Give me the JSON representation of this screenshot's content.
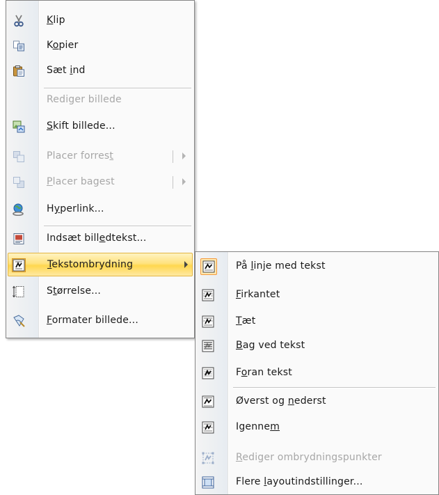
{
  "main_menu": {
    "items": [
      {
        "id": "cut",
        "label": "Klip",
        "accel_index": 0,
        "icon": "scissors-icon",
        "disabled": false
      },
      {
        "id": "copy",
        "label": "Kopier",
        "accel_index": 1,
        "icon": "copy-icon",
        "disabled": false
      },
      {
        "id": "paste",
        "label": "Sæt ind",
        "accel_index": 4,
        "icon": "paste-icon",
        "disabled": false
      },
      {
        "id": "edit-picture",
        "label": "Rediger billede",
        "accel_index": -1,
        "icon": "",
        "disabled": true
      },
      {
        "id": "change-picture",
        "label": "Skift billede...",
        "accel_index": 0,
        "icon": "change-picture-icon",
        "disabled": false
      },
      {
        "id": "bring-to-front",
        "label": "Placer forrest",
        "accel_index": 13,
        "icon": "bring-forward-icon",
        "disabled": true
      },
      {
        "id": "send-to-back",
        "label": "Placer bagest",
        "accel_index": 0,
        "icon": "send-backward-icon",
        "disabled": true
      },
      {
        "id": "hyperlink",
        "label": "Hyperlink...",
        "accel_index": 1,
        "icon": "hyperlink-globe-icon",
        "disabled": false
      },
      {
        "id": "insert-caption",
        "label": "Indsæt billedtekst...",
        "accel_index": 11,
        "icon": "caption-icon",
        "disabled": false
      },
      {
        "id": "text-wrapping",
        "label": "Tekstombrydning",
        "accel_index": 0,
        "icon": "text-wrap-icon",
        "disabled": false
      },
      {
        "id": "size",
        "label": "Størrelse...",
        "accel_index": 1,
        "icon": "size-icon",
        "disabled": false
      },
      {
        "id": "format-picture",
        "label": "Formater billede...",
        "accel_index": 0,
        "icon": "format-picture-icon",
        "disabled": false
      }
    ]
  },
  "sub_menu": {
    "items": [
      {
        "id": "inline",
        "label": "På linje med tekst",
        "accel_index": 3,
        "icon": "wrap-inline-icon",
        "disabled": false
      },
      {
        "id": "square",
        "label": "Firkantet",
        "accel_index": 0,
        "icon": "wrap-square-icon",
        "disabled": false
      },
      {
        "id": "tight",
        "label": "Tæt",
        "accel_index": 0,
        "icon": "wrap-tight-icon",
        "disabled": false
      },
      {
        "id": "behind",
        "label": "Bag ved tekst",
        "accel_index": 0,
        "icon": "wrap-behind-icon",
        "disabled": false
      },
      {
        "id": "in-front",
        "label": "Foran tekst",
        "accel_index": 1,
        "icon": "wrap-front-icon",
        "disabled": false
      },
      {
        "id": "top-bottom",
        "label": "Øverst og nederst",
        "accel_index": 10,
        "icon": "wrap-top-bottom-icon",
        "disabled": false
      },
      {
        "id": "through",
        "label": "Igennem",
        "accel_index": 6,
        "icon": "wrap-through-icon",
        "disabled": false
      },
      {
        "id": "edit-wrap-points",
        "label": "Rediger ombrydningspunkter",
        "accel_index": 0,
        "icon": "edit-wrap-points-icon",
        "disabled": true
      },
      {
        "id": "more-layout",
        "label": "Flere layoutindstillinger...",
        "accel_index": 6,
        "icon": "layout-options-icon",
        "disabled": false
      }
    ]
  }
}
